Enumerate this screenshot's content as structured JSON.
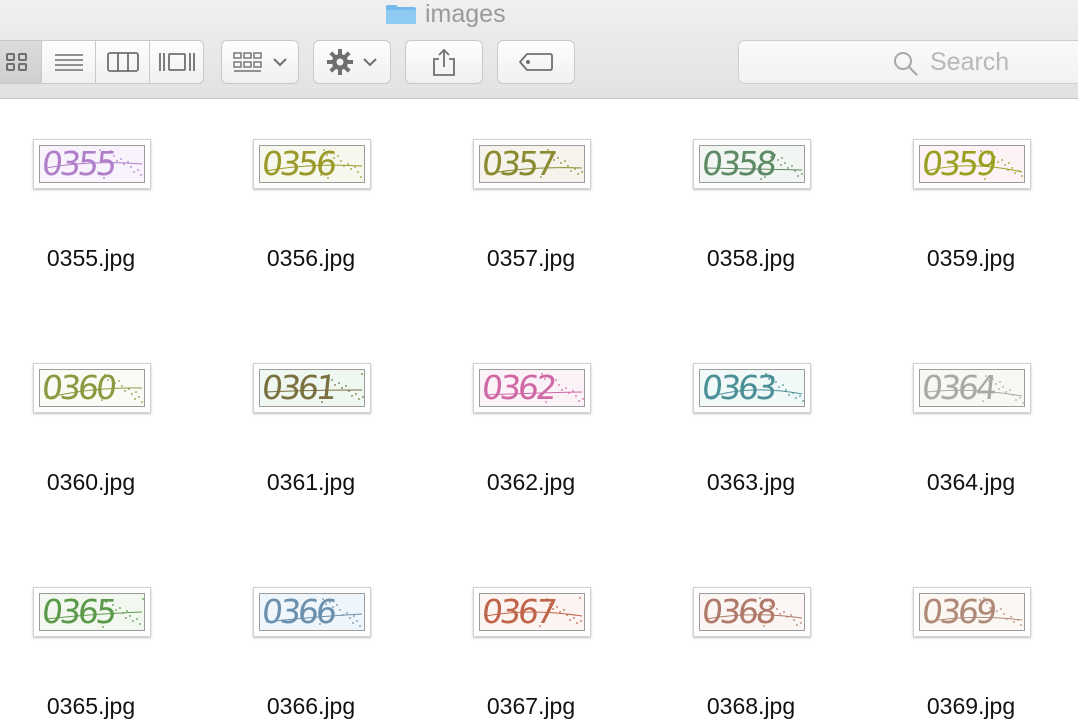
{
  "window": {
    "title": "images",
    "folder_color": "#74b9ec"
  },
  "toolbar": {
    "view_buttons": [
      "icon-view-icon",
      "list-view-icon",
      "column-view-icon",
      "cover-flow-icon"
    ],
    "arrange_icon": "arrange-grid-icon",
    "action_icon": "gear-icon",
    "share_icon": "share-icon",
    "tag_icon": "tag-icon",
    "icon_color": "#6f6f6f"
  },
  "search": {
    "placeholder": "Search"
  },
  "files": [
    {
      "name": "0355.jpg",
      "code": "0355",
      "color": "#b07fc9",
      "bg": "#f7f2fb"
    },
    {
      "name": "0356.jpg",
      "code": "0356",
      "color": "#9a9a2a",
      "bg": "#f6f8ee"
    },
    {
      "name": "0357.jpg",
      "code": "0357",
      "color": "#8a8a30",
      "bg": "#f5f3ec"
    },
    {
      "name": "0358.jpg",
      "code": "0358",
      "color": "#5e8a66",
      "bg": "#f1f6f2"
    },
    {
      "name": "0359.jpg",
      "code": "0359",
      "color": "#9aa020",
      "bg": "#fdf3f7"
    },
    {
      "name": "0360.jpg",
      "code": "0360",
      "color": "#8a9a40",
      "bg": "#fbfbf6"
    },
    {
      "name": "0361.jpg",
      "code": "0361",
      "color": "#7a7040",
      "bg": "#eef7f0"
    },
    {
      "name": "0362.jpg",
      "code": "0362",
      "color": "#d068a6",
      "bg": "#fbf2f8"
    },
    {
      "name": "0363.jpg",
      "code": "0363",
      "color": "#4a9096",
      "bg": "#f1f8f8"
    },
    {
      "name": "0364.jpg",
      "code": "0364",
      "color": "#a8a8a8",
      "bg": "#f8f8f2"
    },
    {
      "name": "0365.jpg",
      "code": "0365",
      "color": "#5a9a4a",
      "bg": "#f2f8ef"
    },
    {
      "name": "0366.jpg",
      "code": "0366",
      "color": "#6a90ae",
      "bg": "#eef5fb"
    },
    {
      "name": "0367.jpg",
      "code": "0367",
      "color": "#c0644a",
      "bg": "#fbf4f1"
    },
    {
      "name": "0368.jpg",
      "code": "0368",
      "color": "#b07a6a",
      "bg": "#fbf6f4"
    },
    {
      "name": "0369.jpg",
      "code": "0369",
      "color": "#b08a78",
      "bg": "#fbf7f2"
    }
  ]
}
